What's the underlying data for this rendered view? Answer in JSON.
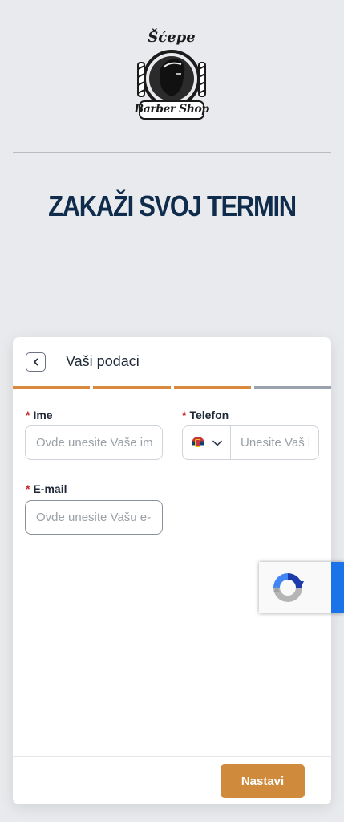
{
  "brand": {
    "logo_top_text": "Šćepe",
    "logo_bottom_text": "Barber Shop",
    "icon": "barber-logo-icon"
  },
  "headline": "ZAKAŽI SVOJ TERMIN",
  "card": {
    "title": "Vaši podaci",
    "back_icon": "chevron-left-icon",
    "steps": [
      "done",
      "done",
      "done",
      "todo"
    ]
  },
  "form": {
    "name": {
      "required_mark": "*",
      "label": "Ime",
      "placeholder": "Ovde unesite Vaše ime"
    },
    "phone": {
      "required_mark": "*",
      "label": "Telefon",
      "country_flag": "serbia-flag-icon",
      "placeholder": "Unesite Vaš broj telefona"
    },
    "email": {
      "required_mark": "*",
      "label": "E-mail",
      "placeholder": "Ovde unesite Vašu e-mail adresu"
    }
  },
  "actions": {
    "submit_label": "Nastavi"
  },
  "colors": {
    "accent": "#d08a3b",
    "headline": "#0f2c4d",
    "background": "#e8eaed",
    "required": "#c62828",
    "recaptcha_blue": "#1a73e8"
  }
}
